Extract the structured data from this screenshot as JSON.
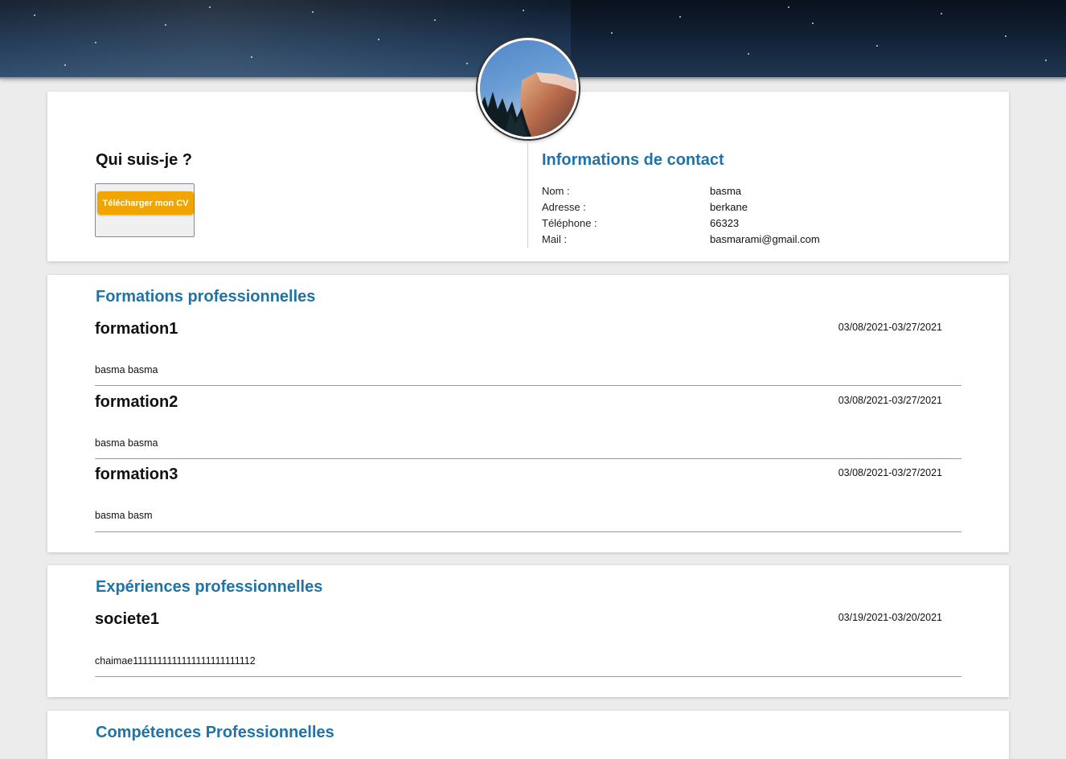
{
  "profile": {
    "who_title": "Qui suis-je ?",
    "cv_button_label": "Télécharger mon CV"
  },
  "contact": {
    "title": "Informations de contact",
    "rows": [
      {
        "label": "Nom :",
        "value": "basma"
      },
      {
        "label": "Adresse :",
        "value": "berkane"
      },
      {
        "label": "Téléphone :",
        "value": "66323"
      },
      {
        "label": "Mail :",
        "value": "basmarami@gmail.com"
      }
    ]
  },
  "formations": {
    "title": "Formations professionnelles",
    "items": [
      {
        "name": "formation1",
        "dates": "03/08/2021-03/27/2021",
        "description": "basma basma"
      },
      {
        "name": "formation2",
        "dates": "03/08/2021-03/27/2021",
        "description": "basma basma"
      },
      {
        "name": "formation3",
        "dates": "03/08/2021-03/27/2021",
        "description": "basma basm"
      }
    ]
  },
  "experiences": {
    "title": "Expériences professionnelles",
    "items": [
      {
        "name": "societe1",
        "dates": "03/19/2021-03/20/2021",
        "description": "chaimae1111111111111111111111112"
      }
    ]
  },
  "competences": {
    "title": "Compétences Professionnelles"
  },
  "colors": {
    "accent": "#1f73a6",
    "button": "#f0a500",
    "background": "#ececec"
  }
}
